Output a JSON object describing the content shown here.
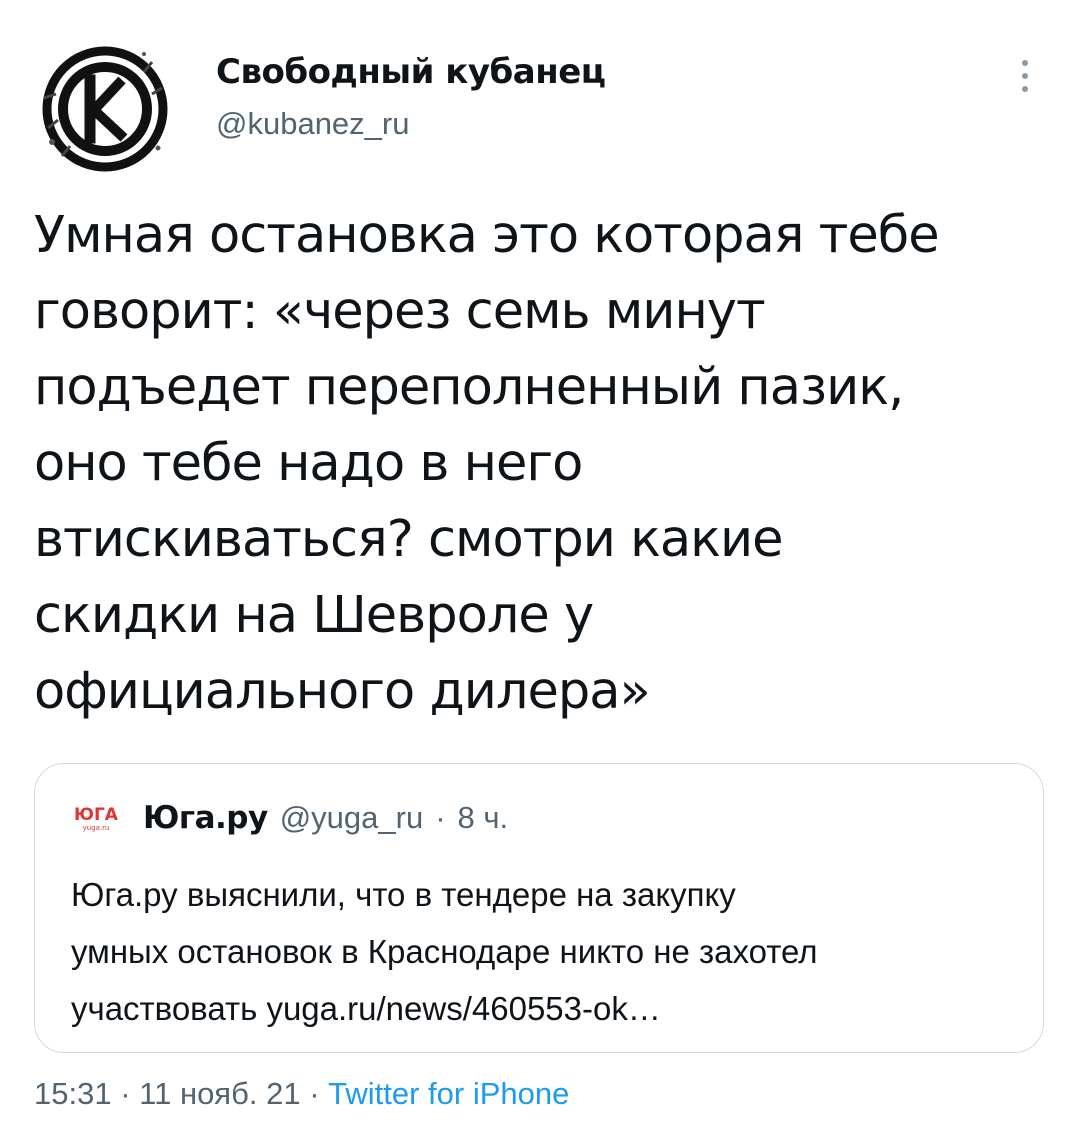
{
  "author": {
    "name": "Свободный кубанец",
    "handle": "@kubanez_ru",
    "avatar_icon": "kubanez-logo-icon"
  },
  "tweet": {
    "text": "Умная остановка это которая тебе\nговорит: «через семь минут\nподъедет переполненный пазик,\nоно тебе надо в него\nвтискиваться? смотри какие\nскидки на Шевроле у\nофициального дилера»"
  },
  "quoted_tweet": {
    "name": "Юга.ру",
    "handle": "@yuga_ru",
    "separator": "·",
    "time": "8 ч.",
    "logo_text": "ЮГА",
    "logo_subtext": "yuga.ru",
    "text": "Юга.ру выяснили, что в тендере на закупку\nумных остановок в Краснодаре никто не захотел\nучаствовать yuga.ru/news/460553-ok…"
  },
  "footer": {
    "time": "15:31",
    "sep1": "·",
    "date": "11 нояб. 21",
    "sep2": "·",
    "source": "Twitter for iPhone"
  },
  "colors": {
    "text": "#0f1419",
    "secondary": "#536471",
    "link": "#1d9bf0",
    "border": "#cfd9de",
    "yuga_red": "#e03535"
  }
}
